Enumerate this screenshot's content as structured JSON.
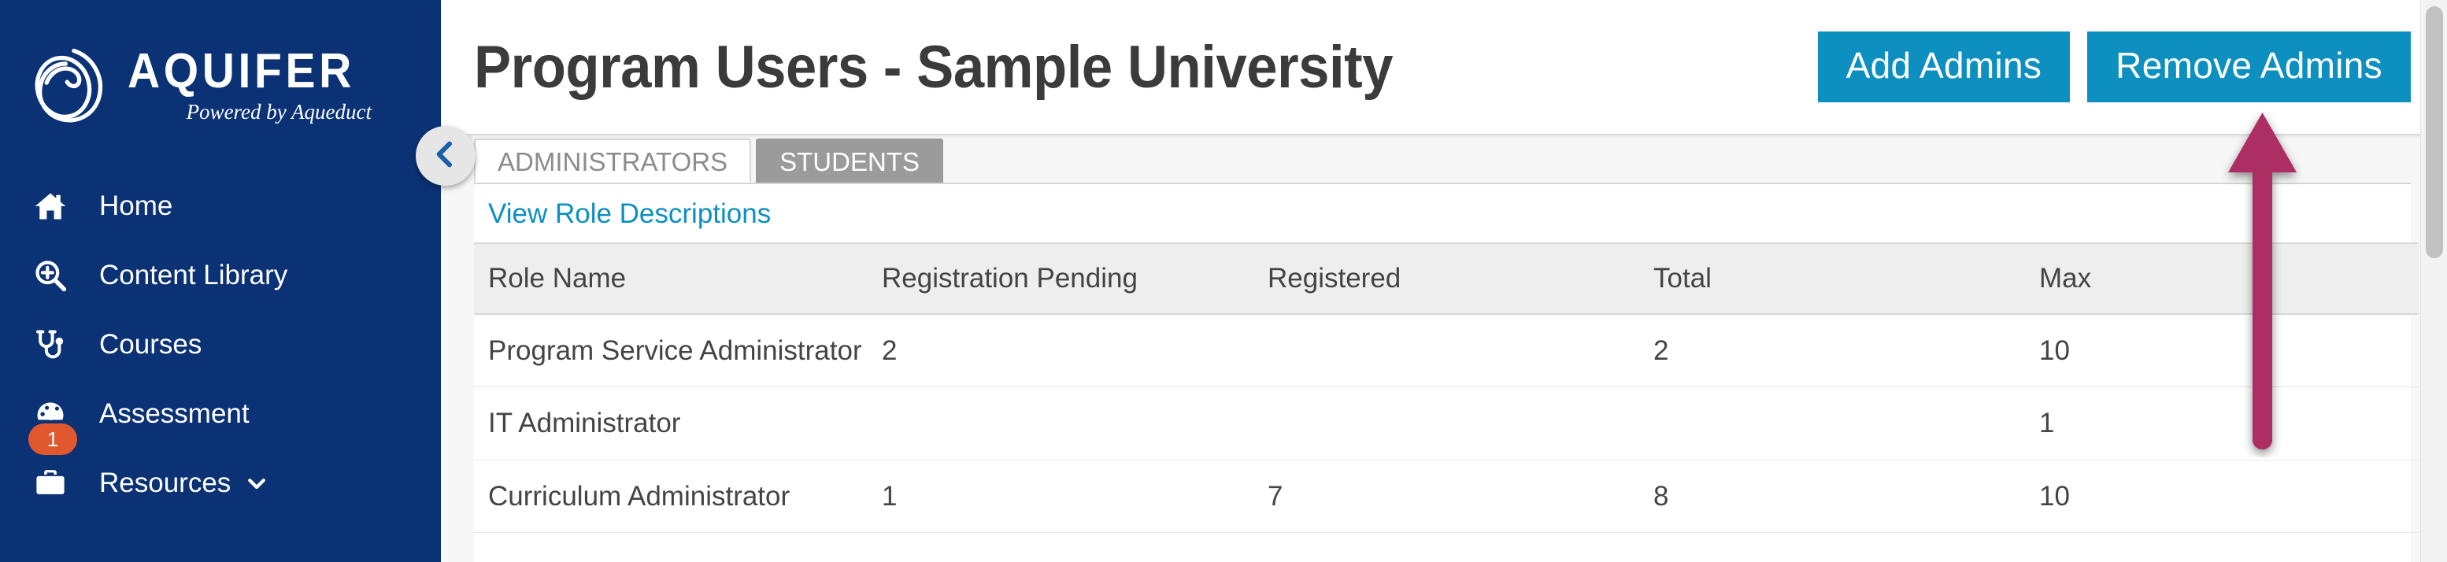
{
  "sidebar": {
    "brand": {
      "name": "AQUIFER",
      "tagline": "Powered by Aqueduct",
      "logo_icon": "aquifer-loop-logo",
      "background_color": "#0b3275"
    },
    "items": [
      {
        "label": "Home",
        "icon": "home-icon",
        "badge": null,
        "has_chevron": false
      },
      {
        "label": "Content Library",
        "icon": "search-plus-icon",
        "badge": null,
        "has_chevron": false
      },
      {
        "label": "Courses",
        "icon": "stethoscope-icon",
        "badge": null,
        "has_chevron": false
      },
      {
        "label": "Assessment",
        "icon": "gauge-icon",
        "badge": "1",
        "has_chevron": false
      },
      {
        "label": "Resources",
        "icon": "briefcase-icon",
        "badge": null,
        "has_chevron": true
      }
    ],
    "collapse_button": {
      "icon": "chevron-left-icon",
      "color": "#1b5fa8"
    }
  },
  "header": {
    "title": "Program Users - Sample University",
    "buttons": [
      {
        "label": "Add Admins",
        "color": "#0d8fc0"
      },
      {
        "label": "Remove Admins",
        "color": "#0d8fc0"
      }
    ]
  },
  "tabs": [
    {
      "label": "ADMINISTRATORS",
      "active": true
    },
    {
      "label": "STUDENTS",
      "active": false
    }
  ],
  "content": {
    "role_descriptions_link": "View Role Descriptions",
    "link_color": "#0d8fc0"
  },
  "table": {
    "columns": [
      "Role Name",
      "Registration Pending",
      "Registered",
      "Total",
      "Max"
    ],
    "rows": [
      {
        "role": "Program Service Administrator",
        "registration_pending": "2",
        "registered": "",
        "total": "2",
        "max": "10"
      },
      {
        "role": "IT Administrator",
        "registration_pending": "",
        "registered": "",
        "total": "",
        "max": "1"
      },
      {
        "role": "Curriculum Administrator",
        "registration_pending": "1",
        "registered": "7",
        "total": "8",
        "max": "10"
      }
    ]
  },
  "annotation": {
    "type": "arrow-up",
    "color": "#ad2f63",
    "points_to": "Remove Admins"
  },
  "scrollbar": {
    "thumb_color": "#c1c1c1",
    "track_color": "#f3f3f3"
  }
}
